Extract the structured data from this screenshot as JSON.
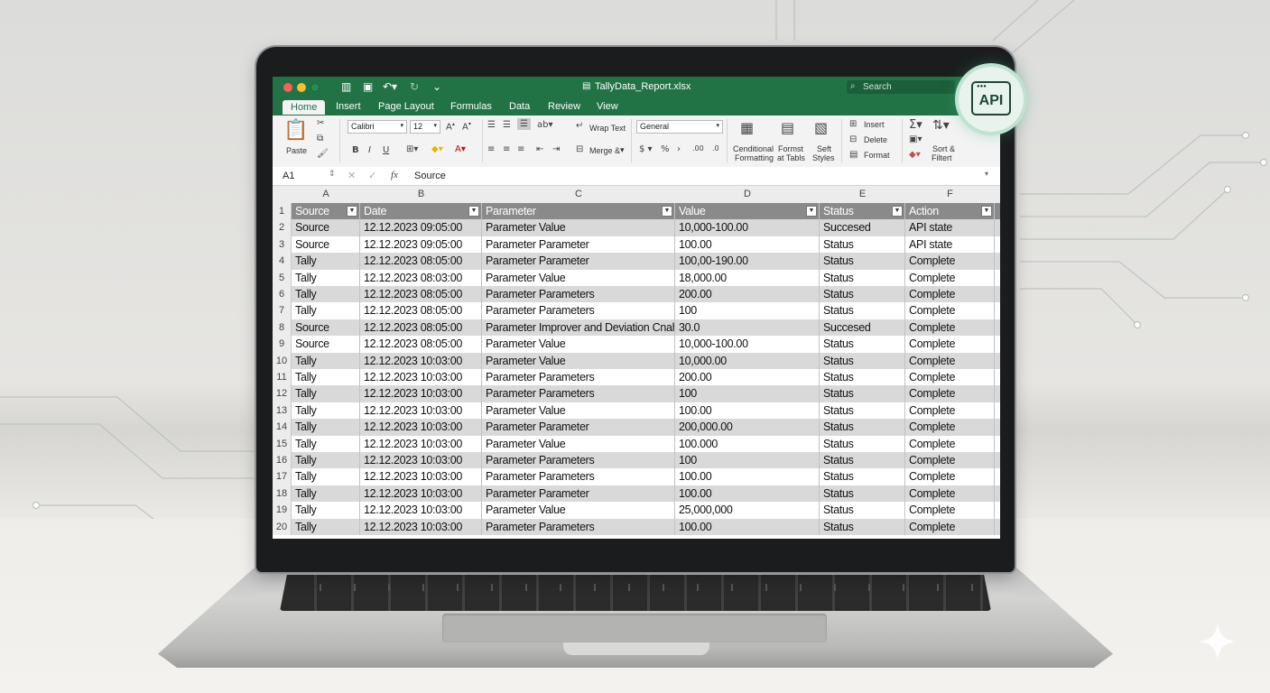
{
  "app": {
    "doc_title": "TallyData_Report.xlsx",
    "search_placeholder": "Search"
  },
  "tabs": [
    "Home",
    "Insert",
    "Page Layout",
    "Formulas",
    "Data",
    "Review",
    "View"
  ],
  "ribbon": {
    "paste": "Paste",
    "font_name": "Calibri",
    "font_size": "12",
    "wrap_text": "Wrap Text",
    "merge": "Merge &",
    "number_format": "General",
    "conditional": [
      "Cenditional",
      "Formatting"
    ],
    "format_table": [
      "Formst",
      "at Tabls"
    ],
    "cell_styles": [
      "Seft",
      "Styles"
    ],
    "insert": "Insert",
    "delete": "Delete",
    "format": "Format",
    "sort": [
      "Sort &",
      "Filtert"
    ]
  },
  "formula_bar": {
    "cell_ref": "A1",
    "fx": "fx",
    "value": "Source"
  },
  "columns": [
    "A",
    "B",
    "C",
    "D",
    "E",
    "F"
  ],
  "table": {
    "headers": [
      "Source",
      "Date",
      "Parameter",
      "Value",
      "Status",
      "Action"
    ],
    "rows": [
      [
        "Source",
        "12.12.2023 09:05:00",
        "Parameter Value",
        "10,000-100.00",
        "Succesed",
        "API state"
      ],
      [
        "Source",
        "12.12.2023 09:05:00",
        "Parameter Parameter",
        "100.00",
        "Status",
        "API state"
      ],
      [
        "Tally",
        "12.12.2023 08:05:00",
        "Parameter Parameter",
        "100,00-190.00",
        "Status",
        "Complete"
      ],
      [
        "Tally",
        "12.12.2023 08:03:00",
        "Parameter Value",
        "18,000.00",
        "Status",
        "Complete"
      ],
      [
        "Tally",
        "12.12.2023 08:05:00",
        "Parameter Parameters",
        "200.00",
        "Status",
        "Complete"
      ],
      [
        "Tally",
        "12.12.2023 08:05:00",
        "Parameter Parameters",
        "100",
        "Status",
        "Complete"
      ],
      [
        "Source",
        "12.12.2023 08:05:00",
        "Parameter Improver and Deviation Cnahs",
        "30.0",
        "Succesed",
        "Complete"
      ],
      [
        "Source",
        "12.12.2023 08:05:00",
        "Parameter Value",
        "10,000-100.00",
        "Status",
        "Complete"
      ],
      [
        "Tally",
        "12.12.2023 10:03:00",
        "Parameter Value",
        "10,000.00",
        "Status",
        "Complete"
      ],
      [
        "Tally",
        "12.12.2023 10:03:00",
        "Parameter Parameters",
        "200.00",
        "Status",
        "Complete"
      ],
      [
        "Tally",
        "12.12.2023 10:03:00",
        "Parameter Parameters",
        "100",
        "Status",
        "Complete"
      ],
      [
        "Tally",
        "12.12.2023 10:03:00",
        "Parameter Value",
        "100.00",
        "Status",
        "Complete"
      ],
      [
        "Tally",
        "12.12.2023 10:03:00",
        "Parameter Parameter",
        "200,000.00",
        "Status",
        "Complete"
      ],
      [
        "Tally",
        "12.12.2023 10:03:00",
        "Parameter Value",
        "100.000",
        "Status",
        "Complete"
      ],
      [
        "Tally",
        "12.12.2023 10:03:00",
        "Parameter Parameters",
        "100",
        "Status",
        "Complete"
      ],
      [
        "Tally",
        "12.12.2023 10:03:00",
        "Parameter Parameters",
        "100.00",
        "Status",
        "Complete"
      ],
      [
        "Tally",
        "12.12.2023 10:03:00",
        "Parameter Parameter",
        "100.00",
        "Status",
        "Complete"
      ],
      [
        "Tally",
        "12.12.2023 10:03:00",
        "Parameter Value",
        "25,000,000",
        "Status",
        "Complete"
      ],
      [
        "Tally",
        "12.12.2023 10:03:00",
        "Parameter Parameters",
        "100.00",
        "Status",
        "Complete"
      ]
    ]
  },
  "badge": {
    "label": "API"
  },
  "colors": {
    "excel_green": "#217346",
    "header_gray": "#8a8a8a",
    "band_gray": "#d9d9d9"
  }
}
